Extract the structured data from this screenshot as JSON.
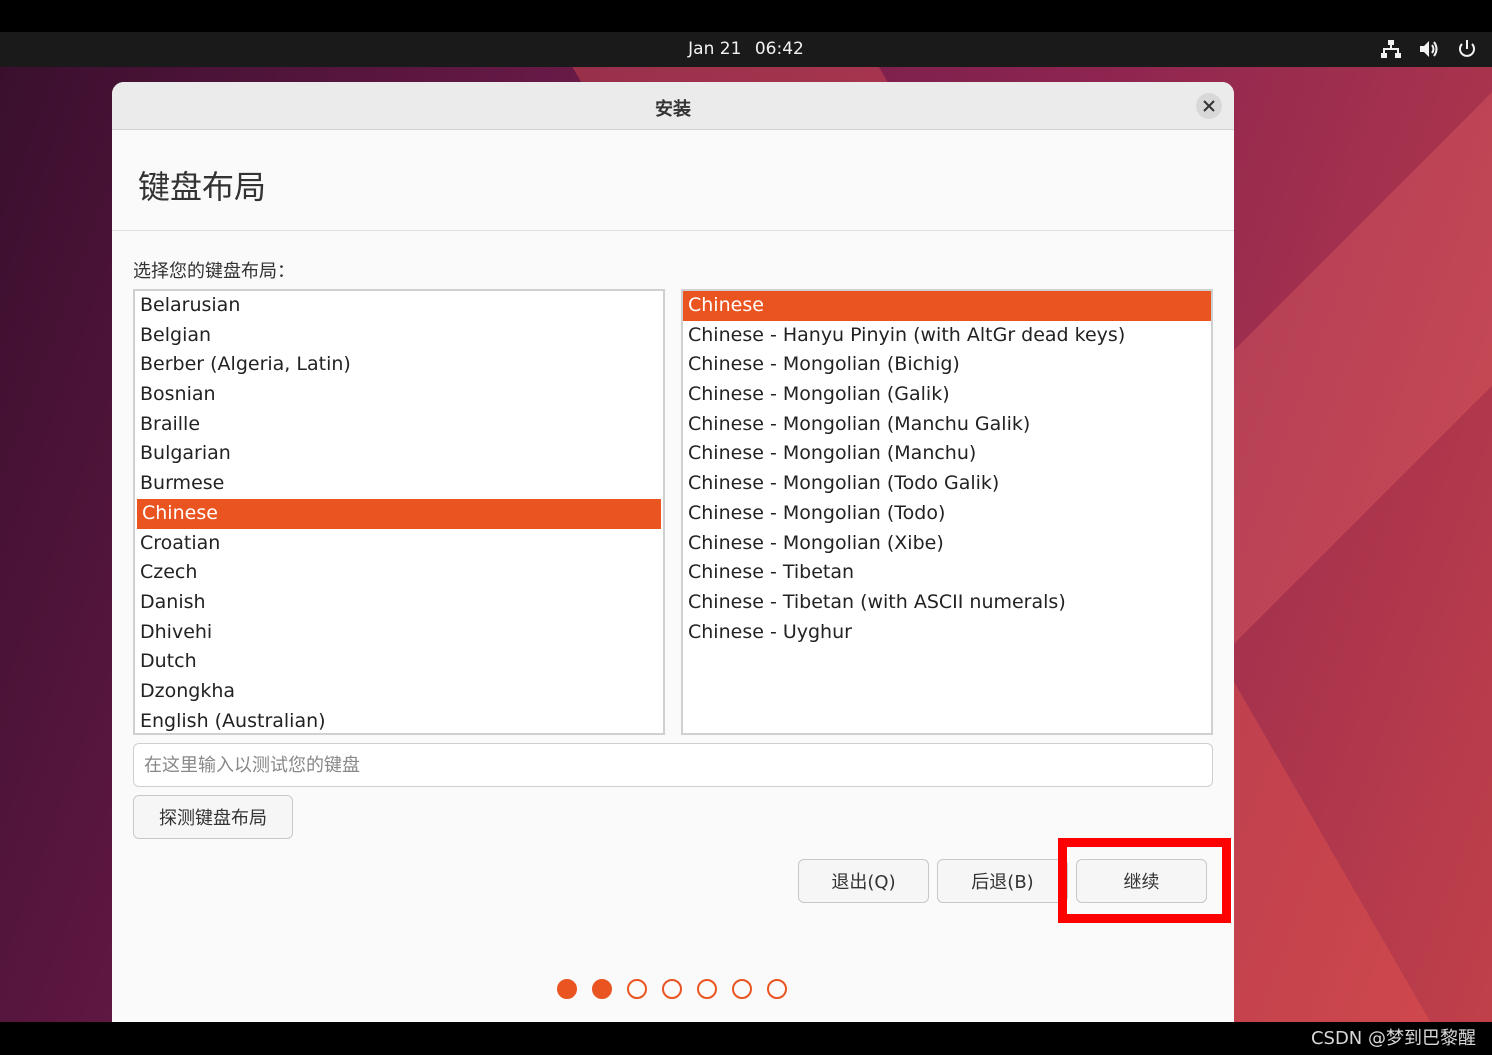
{
  "topbar": {
    "date": "Jan 21",
    "time": "06:42",
    "tray_icons": [
      "network-icon",
      "volume-icon",
      "power-icon"
    ]
  },
  "dialog": {
    "title": "安装",
    "heading": "键盘布局",
    "subtitle": "选择您的键盘布局：",
    "layouts": [
      "Belarusian",
      "Belgian",
      "Berber (Algeria, Latin)",
      "Bosnian",
      "Braille",
      "Bulgarian",
      "Burmese",
      "Chinese",
      "Croatian",
      "Czech",
      "Danish",
      "Dhivehi",
      "Dutch",
      "Dzongkha",
      "English (Australian)"
    ],
    "selected_layout": "Chinese",
    "variants": [
      "Chinese",
      "Chinese - Hanyu Pinyin (with AltGr dead keys)",
      "Chinese - Mongolian (Bichig)",
      "Chinese - Mongolian (Galik)",
      "Chinese - Mongolian (Manchu Galik)",
      "Chinese - Mongolian (Manchu)",
      "Chinese - Mongolian (Todo Galik)",
      "Chinese - Mongolian (Todo)",
      "Chinese - Mongolian (Xibe)",
      "Chinese - Tibetan",
      "Chinese - Tibetan (with ASCII numerals)",
      "Chinese - Uyghur"
    ],
    "selected_variant": "Chinese",
    "test_placeholder": "在这里输入以测试您的键盘",
    "detect_label": "探测键盘布局",
    "quit_label": "退出(Q)",
    "back_label": "后退(B)",
    "continue_label": "继续",
    "progress": {
      "total_steps": 7,
      "completed_steps": 2
    }
  },
  "colors": {
    "accent": "#e95420",
    "highlight_box": "#ff0000"
  },
  "watermark": "CSDN @梦到巴黎醒"
}
